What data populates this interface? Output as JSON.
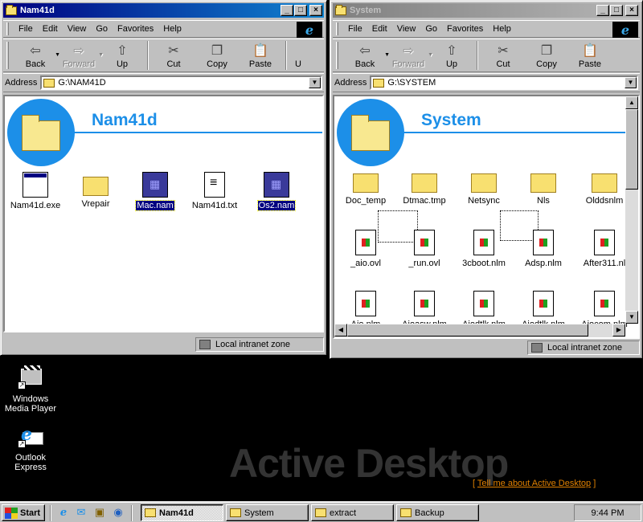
{
  "windows": [
    {
      "title": "Nam41d",
      "menu": [
        "File",
        "Edit",
        "View",
        "Go",
        "Favorites",
        "Help"
      ],
      "toolbar": [
        "Back",
        "Forward",
        "Up",
        "Cut",
        "Copy",
        "Paste",
        "U"
      ],
      "address_label": "Address",
      "address": "G:\\NAM41D",
      "folder_title": "Nam41d",
      "files": [
        {
          "name": "Nam41d.exe",
          "icon": "exe-icon",
          "selected": false
        },
        {
          "name": "Vrepair",
          "icon": "folder-icon",
          "selected": false
        },
        {
          "name": "Mac.nam",
          "icon": "nam-file-icon",
          "selected": true
        },
        {
          "name": "Nam41d.txt",
          "icon": "text-file-icon",
          "selected": false
        },
        {
          "name": "Os2.nam",
          "icon": "nam-file-icon",
          "selected": true
        }
      ],
      "status_zone": "Local intranet zone"
    },
    {
      "title": "System",
      "menu": [
        "File",
        "Edit",
        "View",
        "Go",
        "Favorites",
        "Help"
      ],
      "toolbar": [
        "Back",
        "Forward",
        "Up",
        "Cut",
        "Copy",
        "Paste"
      ],
      "address_label": "Address",
      "address": "G:\\SYSTEM",
      "folder_title": "System",
      "files_row1": [
        "Doc_temp",
        "Dtmac.tmp",
        "Netsync",
        "Nls",
        "Olddsnlm"
      ],
      "files_row2": [
        "_aio.ovl",
        "_run.ovl",
        "3cboot.nlm",
        "Adsp.nlm",
        "After311.nl"
      ],
      "files_row3": [
        "Aio.nlm",
        "Aioasw.nlm",
        "Aiodtlk.nlm",
        "Aiodtlk.nlm",
        "Aiocom.nlm"
      ],
      "status_zone": "Local intranet zone"
    }
  ],
  "desktop_icons": [
    {
      "label_line1": "Windows",
      "label_line2": "Media Player"
    },
    {
      "label_line1": "Outlook",
      "label_line2": "Express"
    }
  ],
  "active_desktop": {
    "heading": "Active Desktop",
    "link_open": "[",
    "link_text": "Tell me about Active Desktop",
    "link_close": "]"
  },
  "taskbar": {
    "start": "Start",
    "tasks": [
      "Nam41d",
      "System",
      "extract",
      "Backup"
    ],
    "clock": "9:44 PM"
  },
  "colors": {
    "accent": "#1c8fe8",
    "title_active": "#000080",
    "desktop": "#000000",
    "link": "#e08000"
  }
}
